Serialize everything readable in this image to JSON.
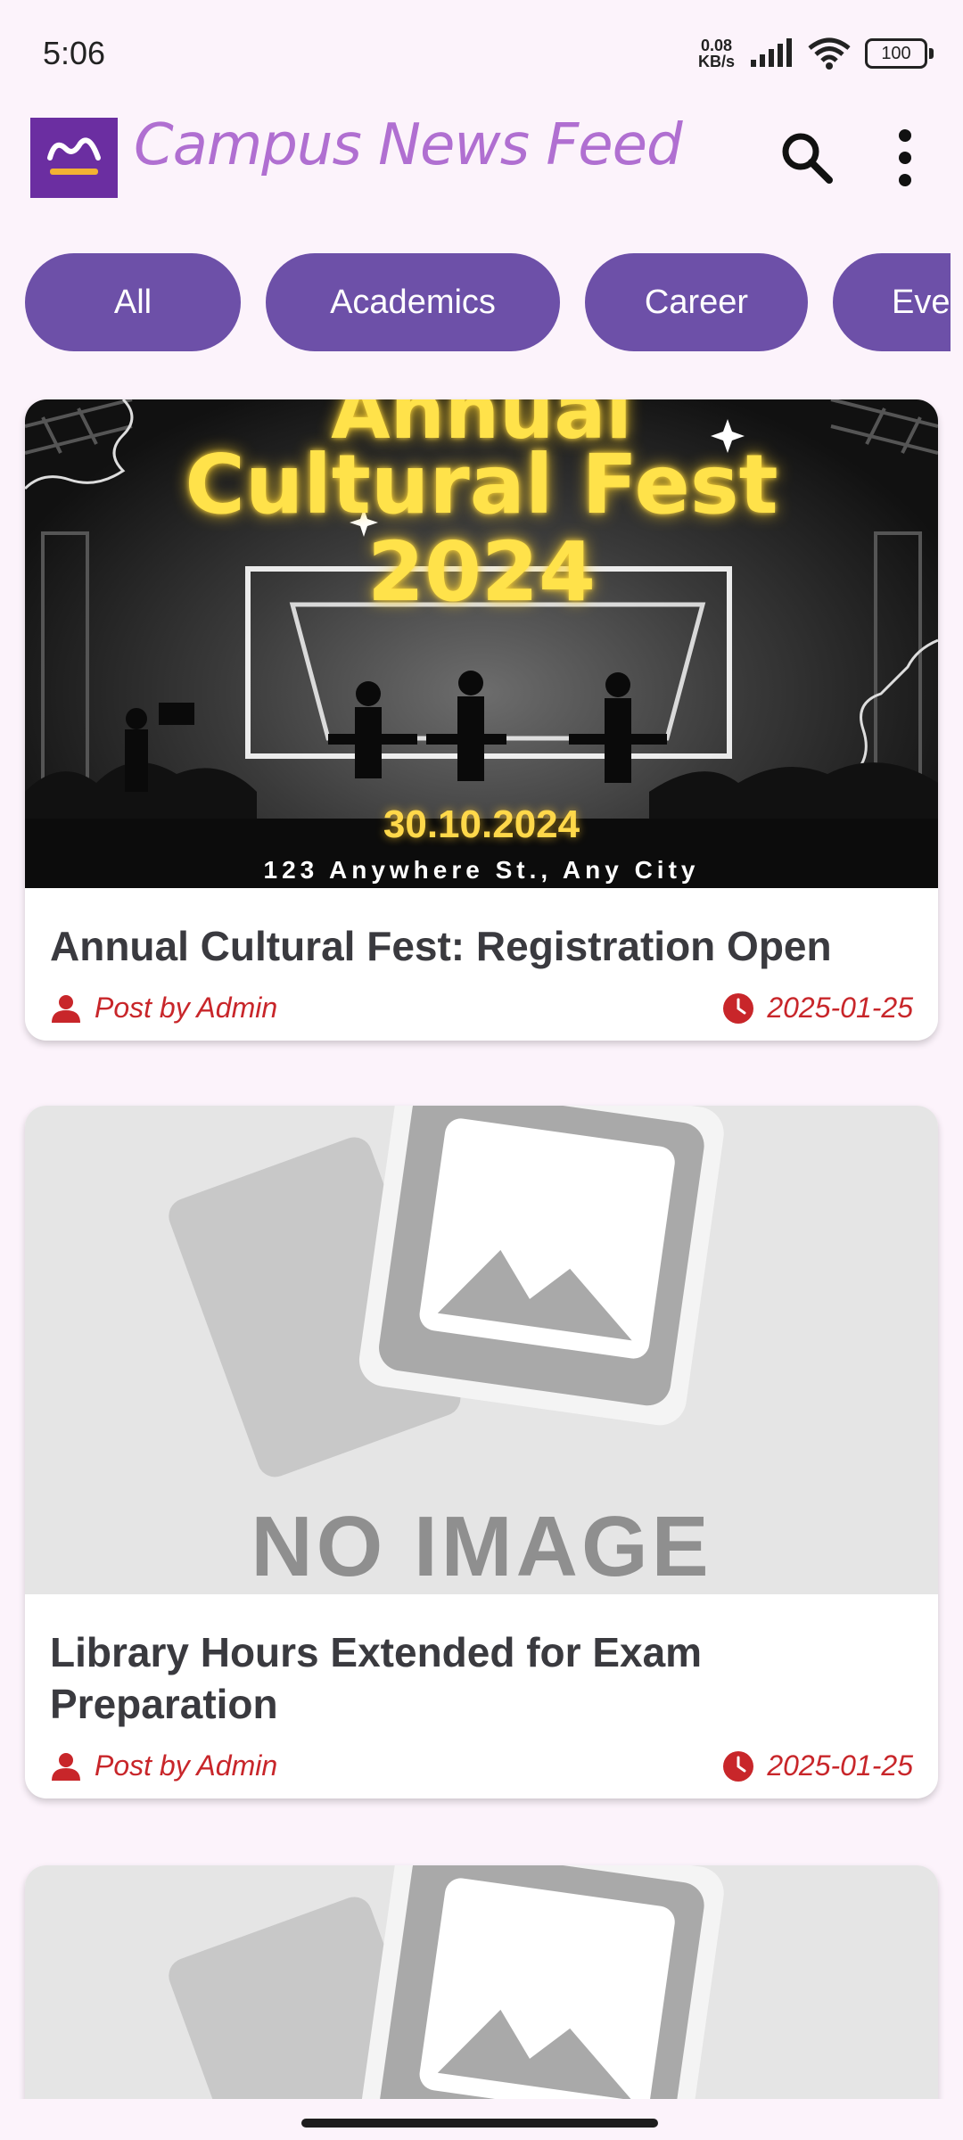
{
  "status": {
    "time": "5:06",
    "net_speed_value": "0.08",
    "net_speed_unit": "KB/s",
    "battery": "100"
  },
  "app": {
    "title": "Campus News Feed"
  },
  "chips": [
    "All",
    "Academics",
    "Career",
    "Events"
  ],
  "cards": [
    {
      "title": "Annual Cultural Fest: Registration Open",
      "author": "Post by Admin",
      "date": "2025-01-25",
      "image": {
        "line1": "Annual",
        "line2": "Cultural Fest",
        "line3": "2024",
        "date": "30.10.2024",
        "address": "123 Anywhere St., Any City"
      }
    },
    {
      "title": "Library Hours Extended for Exam Preparation",
      "author": "Post by Admin",
      "date": "2025-01-25",
      "image": {
        "placeholder": "NO IMAGE"
      }
    }
  ]
}
